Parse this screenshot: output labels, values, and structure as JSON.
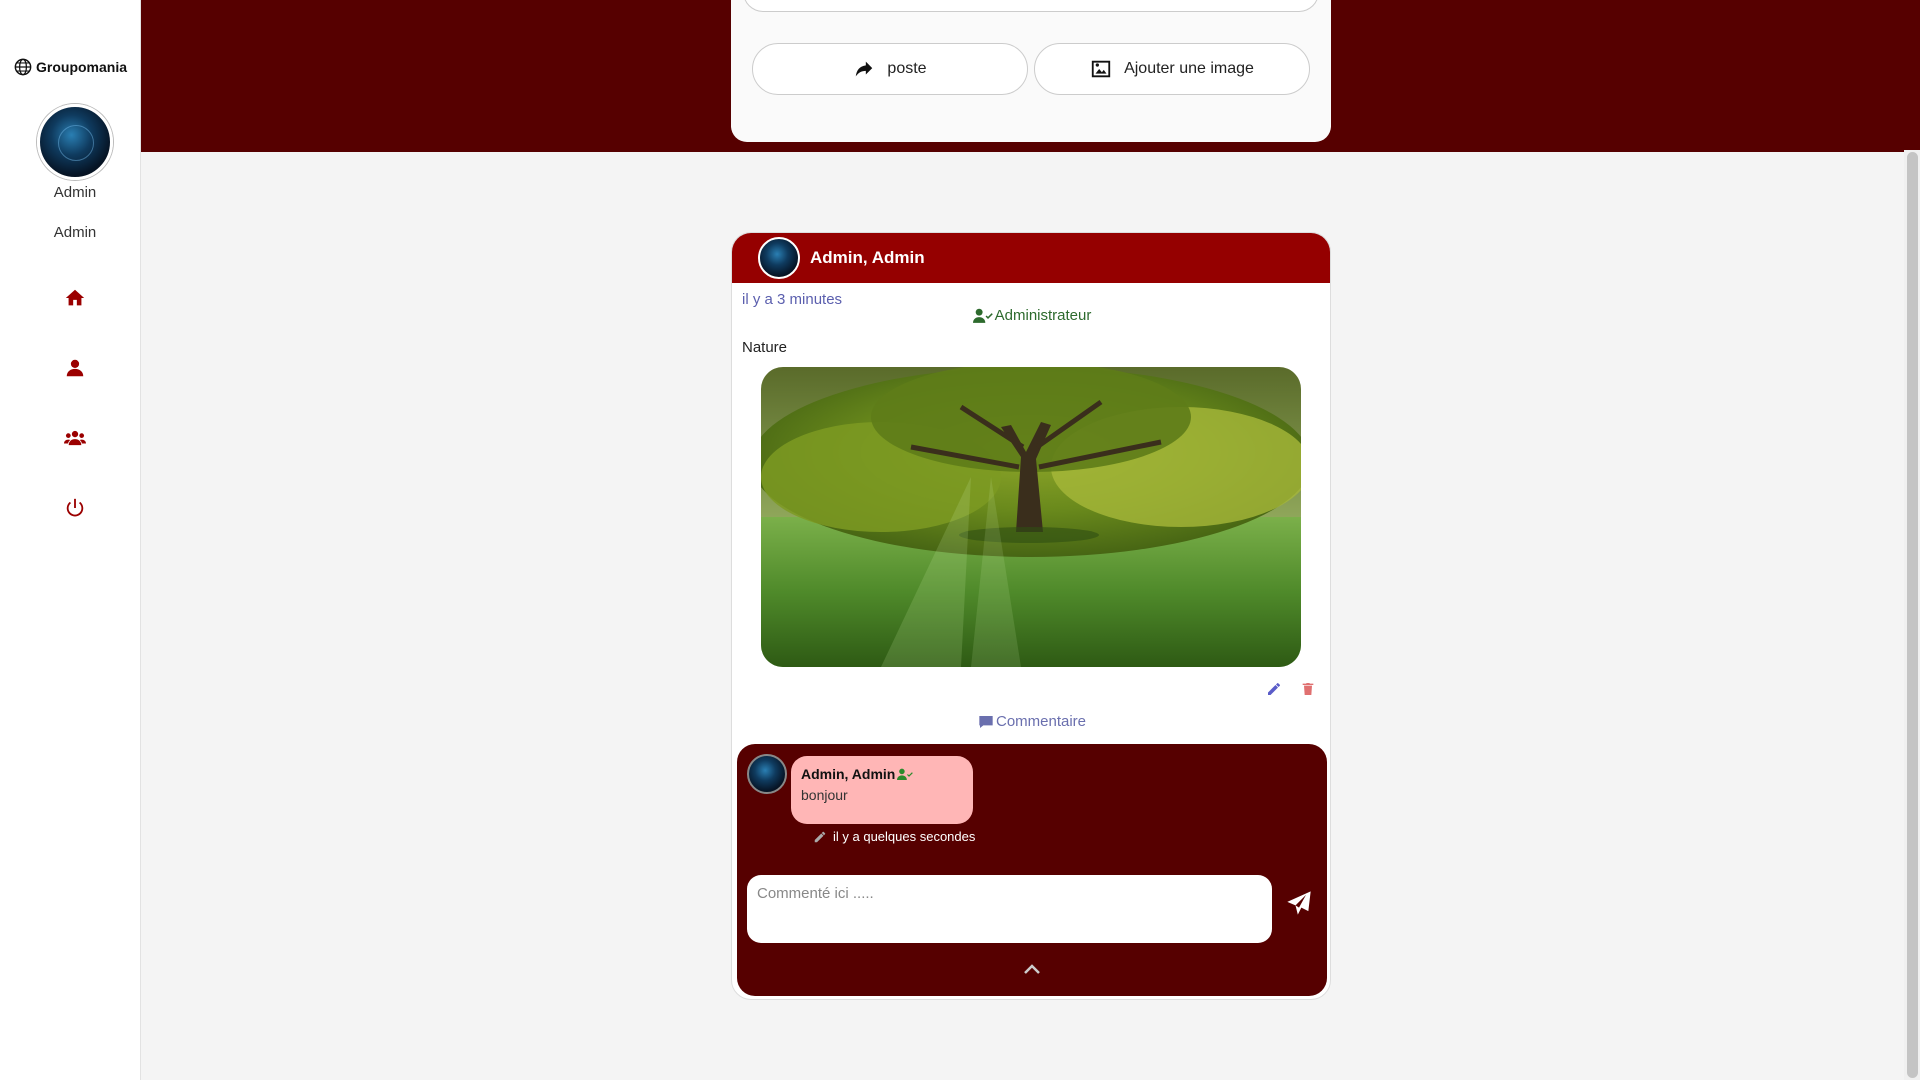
{
  "app": {
    "brand": "Groupomania"
  },
  "sidebar": {
    "first_name": "Admin",
    "last_name": "Admin",
    "nav": [
      {
        "name": "home",
        "icon": "home-icon"
      },
      {
        "name": "profile",
        "icon": "user-icon"
      },
      {
        "name": "users",
        "icon": "users-icon"
      },
      {
        "name": "logout",
        "icon": "power-icon"
      }
    ]
  },
  "composer": {
    "post_label": "poste",
    "image_label": "Ajouter une image"
  },
  "post": {
    "author": "Admin, Admin",
    "time": "il y a 3 minutes",
    "role": "Administrateur",
    "text": "Nature",
    "comment_label": "Commentaire",
    "comments": [
      {
        "author": "Admin, Admin",
        "text": "bonjour",
        "time": "il y a quelques secondes"
      }
    ],
    "comment_placeholder": "Commenté ici ....."
  },
  "colors": {
    "banner": "#560000",
    "header": "#950000",
    "accent": "#9b0000",
    "bubble": "#ffb6b6",
    "role_green": "#2d6a2d"
  }
}
